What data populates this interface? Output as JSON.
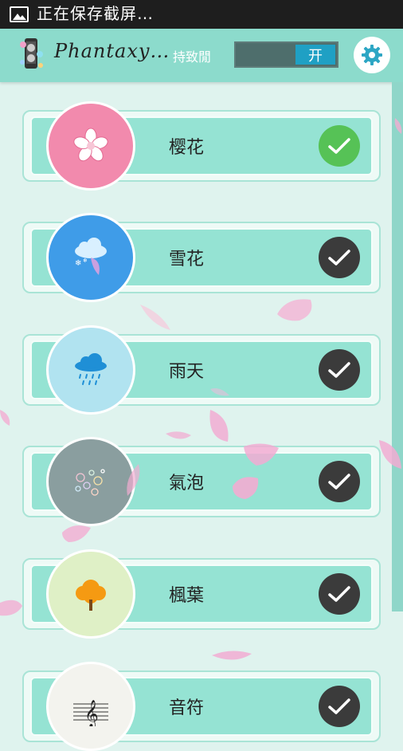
{
  "status_bar": {
    "text": "正在保存截屏…",
    "icon": "image-icon"
  },
  "header": {
    "app_title": "Phantaxy…",
    "keep_open_label": "持致閒",
    "toggle_label": "开",
    "settings_icon": "gear-icon"
  },
  "effects": [
    {
      "label": "樱花",
      "icon": "cherry-blossom-icon",
      "color": "#f28aad",
      "selected": true
    },
    {
      "label": "雪花",
      "icon": "snow-cloud-icon",
      "color": "#3f9ce8",
      "selected": false
    },
    {
      "label": "雨天",
      "icon": "rain-cloud-icon",
      "color": "#b1e3f0",
      "selected": false
    },
    {
      "label": "氣泡",
      "icon": "bubbles-icon",
      "color": "#8a9e9f",
      "selected": false
    },
    {
      "label": "楓葉",
      "icon": "tree-icon",
      "color": "#dff0c6",
      "selected": false
    },
    {
      "label": "音符",
      "icon": "music-staff-icon",
      "color": "#f3f3ee",
      "selected": false
    }
  ],
  "colors": {
    "header": "#8cdbcc",
    "card": "#95e3d3",
    "check_on": "#56c256",
    "check_off": "#3b3b3b",
    "toggle_on": "#1fa0c4"
  }
}
